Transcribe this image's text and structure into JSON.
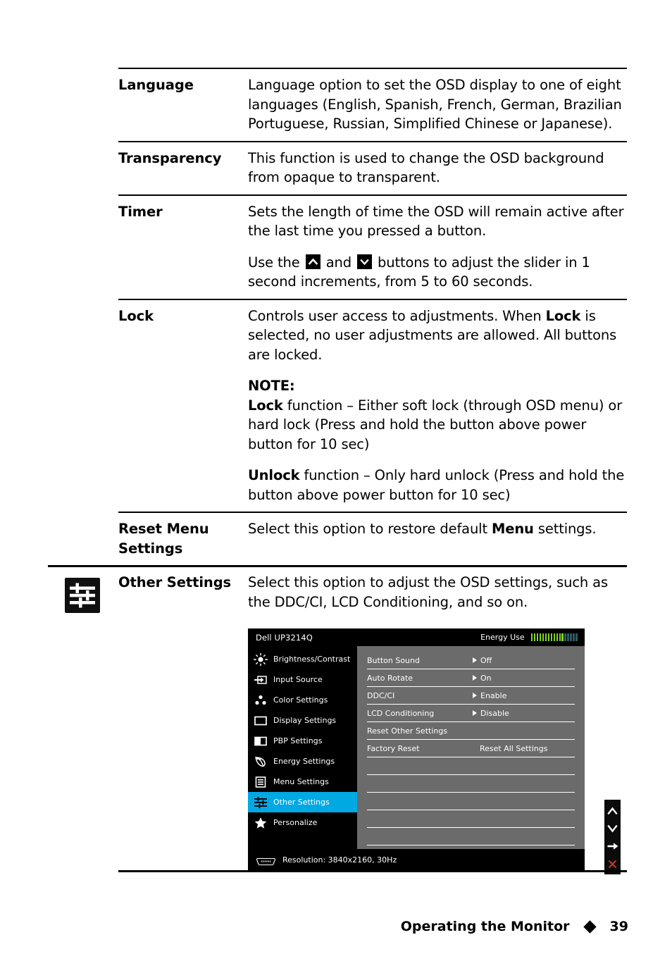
{
  "page": {
    "footer_title": "Operating the Monitor",
    "footer_page_number": "39",
    "accent_blue": "#00a9e4",
    "panel_gray": "#6b6b6b",
    "energy_green": "#7ed321",
    "energy_dim": "#2d5a62"
  },
  "rows": {
    "language": {
      "term": "Language",
      "desc": "Language option to set the OSD display to one of eight languages (English, Spanish, French, German, Brazilian Portuguese, Russian, Simplified Chinese or Japanese)."
    },
    "transparency": {
      "term": "Transparency",
      "desc": "This function is used to change the OSD background from opaque to transparent."
    },
    "timer": {
      "term": "Timer",
      "desc_p1": "Sets the length of time the OSD will remain active after the last time you pressed a button.",
      "p2_a": "Use the ",
      "p2_b": " and ",
      "p2_c": " buttons to adjust the slider in 1 second increments, from 5 to 60 seconds.",
      "up_key": "up-chevron-key",
      "down_key": "down-chevron-key"
    },
    "lock": {
      "term": "Lock",
      "p1_a": "Controls user access to adjustments. When ",
      "p1_bold": "Lock",
      "p1_b": " is  selected, no user adjustments are allowed. All buttons are locked.",
      "note_heading": "NOTE:",
      "note1_bold": "Lock",
      "note1_rest": " function – Either soft lock (through OSD menu) or hard lock (Press and hold the button above power button for 10 sec)",
      "note2_bold": "Unlock",
      "note2_rest": " function – Only hard unlock (Press and hold the button above power button for 10 sec)"
    },
    "reset_menu_settings": {
      "term_line1": "Reset Menu",
      "term_line2": "Settings",
      "desc_a": "Select this option to restore default ",
      "desc_bold": "Menu",
      "desc_b": " settings."
    },
    "other_settings": {
      "term": "Other Settings",
      "desc": "Select this option to adjust the OSD settings, such as the DDC/CI, LCD Conditioning, and so on.",
      "gutter_icon": "sliders-icon"
    }
  },
  "osd": {
    "title": "Dell UP3214Q",
    "energy_label": "Energy Use",
    "energy_bars_lit": 12,
    "energy_bars_dim": 5,
    "sidebar": [
      {
        "label": "Brightness/Contrast",
        "icon": "brightness-icon",
        "selected": false
      },
      {
        "label": "Input Source",
        "icon": "input-source-icon",
        "selected": false
      },
      {
        "label": "Color Settings",
        "icon": "color-settings-icon",
        "selected": false
      },
      {
        "label": "Display Settings",
        "icon": "display-settings-icon",
        "selected": false
      },
      {
        "label": "PBP Settings",
        "icon": "pbp-settings-icon",
        "selected": false
      },
      {
        "label": "Energy Settings",
        "icon": "leaf-icon",
        "selected": false
      },
      {
        "label": "Menu Settings",
        "icon": "menu-settings-icon",
        "selected": false
      },
      {
        "label": "Other Settings",
        "icon": "sliders-icon",
        "selected": true
      },
      {
        "label": "Personalize",
        "icon": "star-icon",
        "selected": false
      }
    ],
    "options": [
      {
        "name": "Button Sound",
        "value": "Off",
        "arrow": true
      },
      {
        "name": "Auto Rotate",
        "value": "On",
        "arrow": true
      },
      {
        "name": "DDC/CI",
        "value": "Enable",
        "arrow": true
      },
      {
        "name": "LCD Conditioning",
        "value": "Disable",
        "arrow": true
      },
      {
        "name": "Reset Other Settings",
        "value": "",
        "arrow": false
      },
      {
        "name": "Factory Reset",
        "value": "Reset All Settings",
        "arrow": false
      }
    ],
    "blank_rows": 5,
    "resolution_text": "Resolution: 3840x2160, 30Hz",
    "resolution_icon": "hdmi-connector-icon",
    "nav": [
      {
        "name": "nav-up-button",
        "icon": "up-chevron-icon"
      },
      {
        "name": "nav-down-button",
        "icon": "down-chevron-icon"
      },
      {
        "name": "nav-enter-button",
        "icon": "right-arrow-icon"
      },
      {
        "name": "nav-exit-button",
        "icon": "close-x-icon"
      }
    ]
  }
}
